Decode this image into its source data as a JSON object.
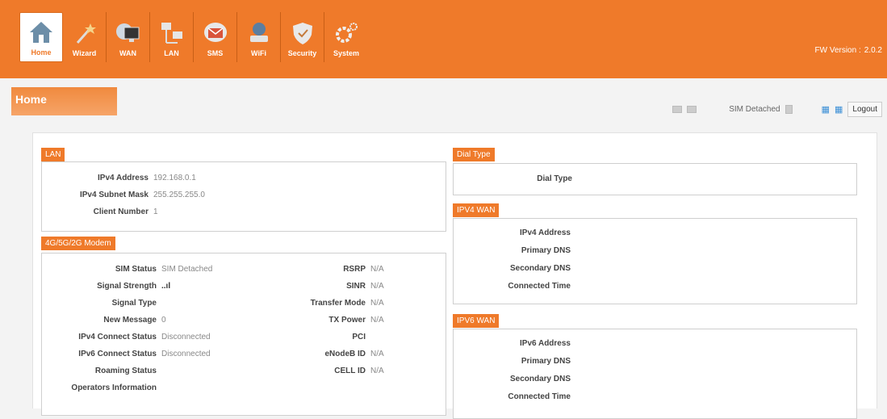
{
  "nav": {
    "items": [
      {
        "label": "Home"
      },
      {
        "label": "Wizard"
      },
      {
        "label": "WAN"
      },
      {
        "label": "LAN"
      },
      {
        "label": "SMS"
      },
      {
        "label": "WiFi"
      },
      {
        "label": "Security"
      },
      {
        "label": "System"
      }
    ],
    "fw_label": "FW Version :",
    "fw_value": "2.0.2"
  },
  "page": {
    "title": "Home",
    "sim_status": "SIM Detached",
    "logout": "Logout"
  },
  "lan": {
    "title": "LAN",
    "ipv4_address_label": "IPv4 Address",
    "ipv4_address": "192.168.0.1",
    "subnet_label": "IPv4 Subnet Mask",
    "subnet": "255.255.255.0",
    "client_label": "Client Number",
    "client": "1"
  },
  "modem": {
    "title": "4G/5G/2G Modem",
    "sim_status_label": "SIM Status",
    "sim_status": "SIM Detached",
    "signal_strength_label": "Signal Strength",
    "signal_strength": "..ıl",
    "signal_type_label": "Signal Type",
    "new_message_label": "New Message",
    "new_message": "0",
    "ipv4_conn_label": "IPv4 Connect Status",
    "ipv4_conn": "Disconnected",
    "ipv6_conn_label": "IPv6 Connect Status",
    "ipv6_conn": "Disconnected",
    "roaming_label": "Roaming Status",
    "operators_label": "Operators Information",
    "rsrp_label": "RSRP",
    "rsrp": "N/A",
    "sinr_label": "SINR",
    "sinr": "N/A",
    "transfer_label": "Transfer Mode",
    "transfer": "N/A",
    "tx_label": "TX Power",
    "tx": "N/A",
    "pci_label": "PCI",
    "enodeb_label": "eNodeB ID",
    "enodeb": "N/A",
    "cellid_label": "CELL ID",
    "cellid": "N/A"
  },
  "dial": {
    "title": "Dial Type",
    "label": "Dial Type"
  },
  "ipv4wan": {
    "title": "IPV4 WAN",
    "addr_label": "IPv4 Address",
    "pdns_label": "Primary DNS",
    "sdns_label": "Secondary DNS",
    "time_label": "Connected Time"
  },
  "ipv6wan": {
    "title": "IPV6 WAN",
    "addr_label": "IPv6 Address",
    "pdns_label": "Primary DNS",
    "sdns_label": "Secondary DNS",
    "time_label": "Connected Time"
  }
}
